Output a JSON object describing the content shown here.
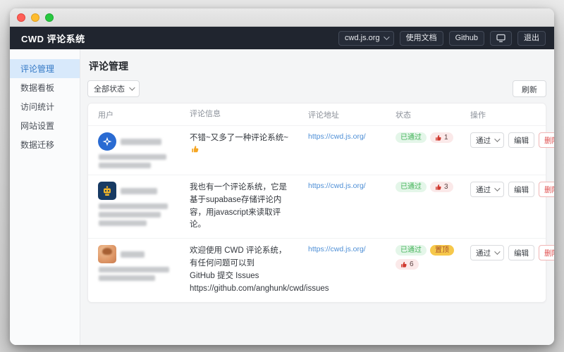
{
  "window": {
    "header": {
      "app_title": "CWD 评论系统",
      "site_select": "cwd.js.org",
      "docs_button": "使用文档",
      "github_button": "Github",
      "logout_button": "退出"
    }
  },
  "sidebar": {
    "items": [
      {
        "label": "评论管理",
        "active": true
      },
      {
        "label": "数据看板",
        "active": false
      },
      {
        "label": "访问统计",
        "active": false
      },
      {
        "label": "网站设置",
        "active": false
      },
      {
        "label": "数据迁移",
        "active": false
      }
    ]
  },
  "main": {
    "page_title": "评论管理",
    "filter_select": "全部状态",
    "refresh_button": "刷新",
    "table": {
      "headers": [
        "用户",
        "评论信息",
        "评论地址",
        "状态",
        "操作"
      ],
      "rows": [
        {
          "comment": "不错~又多了一种评论系统~",
          "comment_emoji": "👍",
          "url": "https://cwd.js.org/",
          "status": "已通过",
          "likes": "1",
          "action_select": "通过",
          "edit_button": "编辑",
          "delete_button": "删除"
        },
        {
          "comment": "我也有一个评论系统，它是基于supabase存储评论内容，用javascript来读取评论。",
          "url": "https://cwd.js.org/",
          "status": "已通过",
          "likes": "3",
          "action_select": "通过",
          "edit_button": "编辑",
          "delete_button": "删除"
        },
        {
          "comment": "欢迎使用 CWD 评论系统，有任何问题可以到\nGitHub 提交 Issues\nhttps://github.com/anghunk/cwd/issues",
          "url": "https://cwd.js.org/",
          "status": "已通过",
          "pinned": "置顶",
          "likes": "6",
          "action_select": "通过",
          "edit_button": "编辑",
          "delete_button": "删除"
        }
      ]
    }
  },
  "colors": {
    "header_dark": "#20252f",
    "active_item_blue": "#d8e9fb",
    "link_blue": "#4e8fd6",
    "status_green_bg": "#e4f6e9",
    "status_green_text": "#46b45a",
    "pin_yellow_bg": "#f6c84b",
    "like_pink_bg": "#fbe9e9",
    "like_thumb_red": "#d0382e",
    "delete_red": "#e05252"
  }
}
